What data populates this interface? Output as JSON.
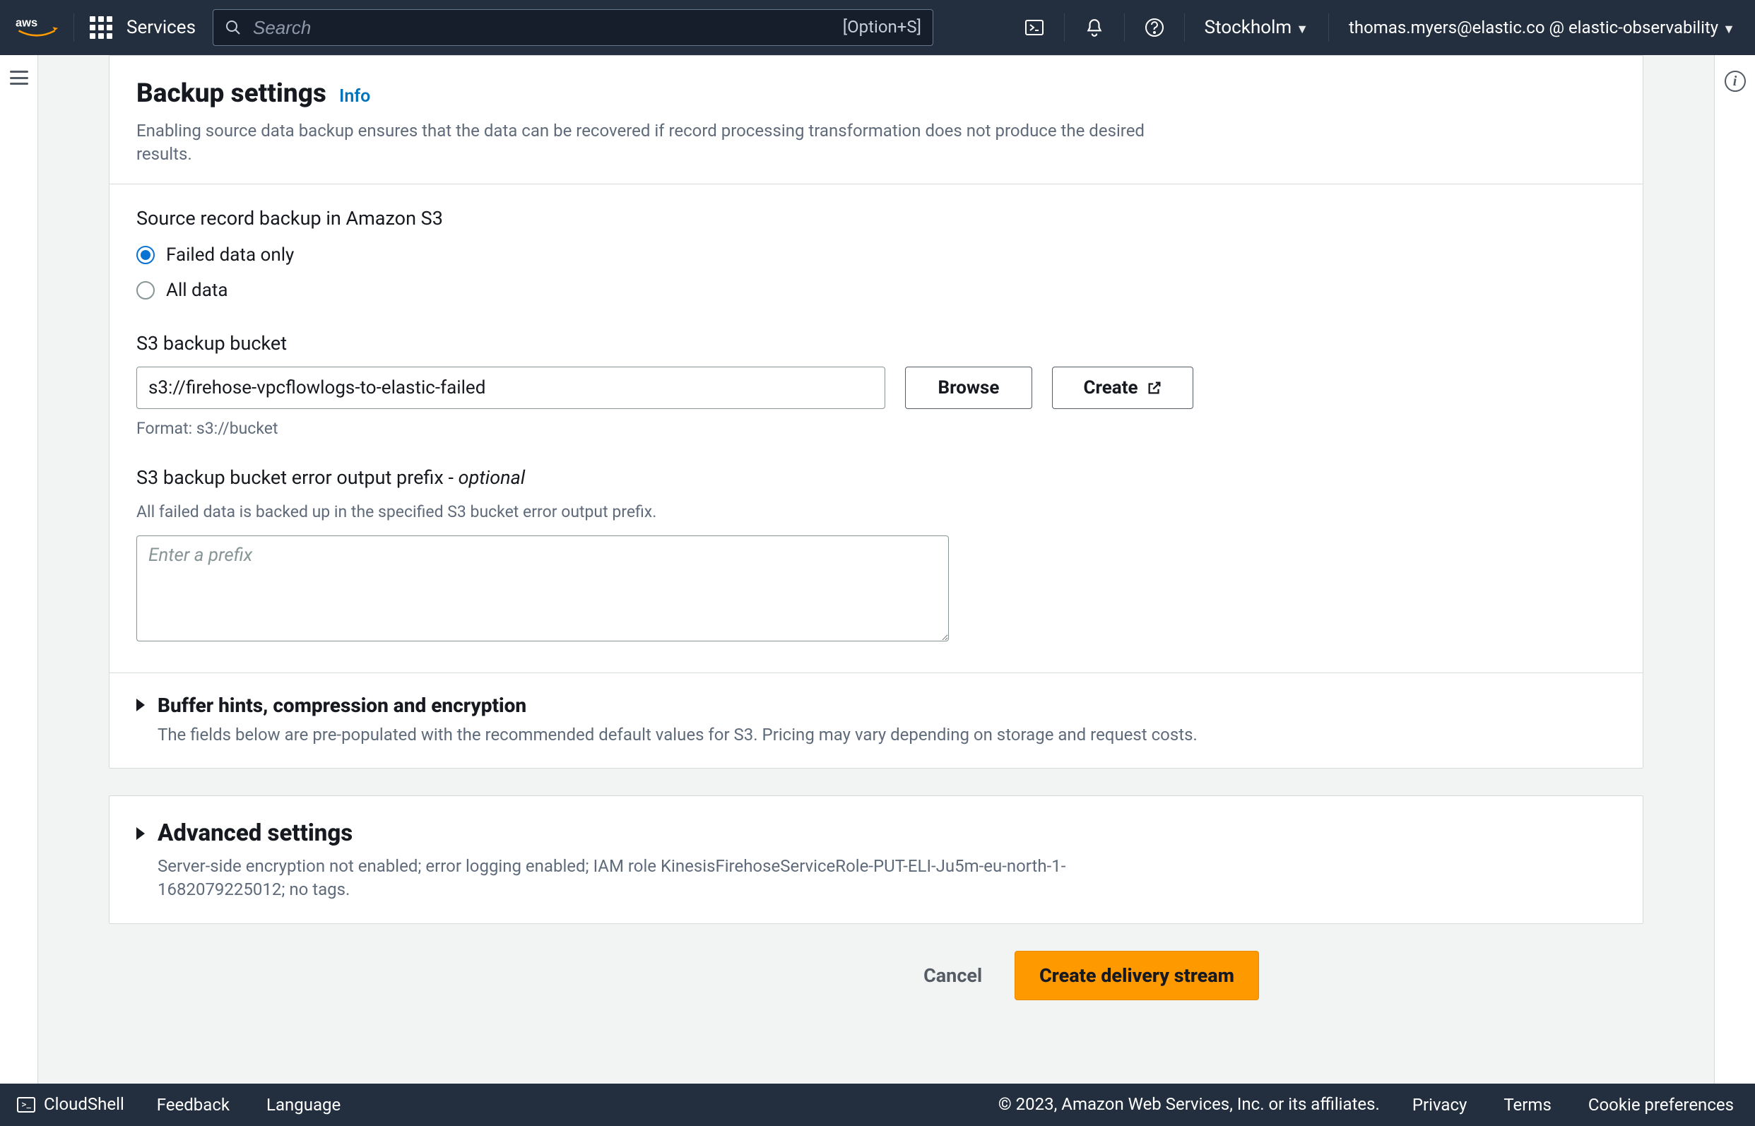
{
  "nav": {
    "services_label": "Services",
    "search_placeholder": "Search",
    "search_hint": "[Option+S]",
    "region": "Stockholm",
    "account": "thomas.myers@elastic.co @ elastic-observability"
  },
  "panel_backup": {
    "title": "Backup settings",
    "info_label": "Info",
    "description": "Enabling source data backup ensures that the data can be recovered if record processing transformation does not produce the desired results.",
    "source_backup_label": "Source record backup in Amazon S3",
    "radio_failed": "Failed data only",
    "radio_all": "All data",
    "bucket_label": "S3 backup bucket",
    "bucket_value": "s3://firehose-vpcflowlogs-to-elastic-failed",
    "bucket_hint": "Format: s3://bucket",
    "browse_label": "Browse",
    "create_label": "Create",
    "error_prefix_label_main": "S3 backup bucket error output prefix - ",
    "error_prefix_label_optional": "optional",
    "error_prefix_desc": "All failed data is backed up in the specified S3 bucket error output prefix.",
    "error_prefix_placeholder": "Enter a prefix"
  },
  "panel_buffer": {
    "title": "Buffer hints, compression and encryption",
    "desc": "The fields below are pre-populated with the recommended default values for S3. Pricing may vary depending on storage and request costs."
  },
  "panel_advanced": {
    "title": "Advanced settings",
    "desc": "Server-side encryption not enabled; error logging enabled; IAM role KinesisFirehoseServiceRole-PUT-ELI-Ju5m-eu-north-1-1682079225012; no tags."
  },
  "actions": {
    "cancel": "Cancel",
    "create_stream": "Create delivery stream"
  },
  "footer": {
    "cloudshell": "CloudShell",
    "feedback": "Feedback",
    "language": "Language",
    "copyright": "© 2023, Amazon Web Services, Inc. or its affiliates.",
    "privacy": "Privacy",
    "terms": "Terms",
    "cookies": "Cookie preferences"
  }
}
